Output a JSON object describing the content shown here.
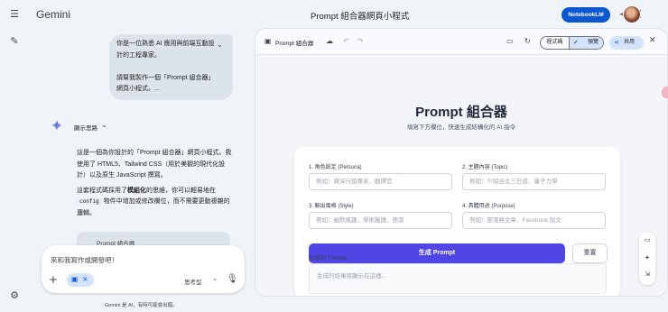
{
  "app": {
    "brand": "Gemini",
    "title": "Prompt 組合器網頁小程式",
    "notebooklm_label": "NotebookLM"
  },
  "icons": {
    "menu": "menu-icon",
    "new_chat": "edit-icon",
    "settings": "gear-icon",
    "share": "share-icon",
    "more": "more-vert-icon",
    "spark": "gemini-spark-icon"
  },
  "chat": {
    "user_message": "你是一位熟悉 AI 應用與前端互動設計的工程專家。\n\n請幫我製作一個「Prompt 組合器」網頁小程式。...",
    "thinking_label": "顯示思路",
    "response_p1": "這是一個為你設計的「Prompt 組合器」網頁小程式。我使用了 HTML5、Tailwind CSS（用於美觀的現代化設計）以及原生 JavaScript 撰寫。",
    "response_p2_a": "這套程式碼採用了",
    "response_p2_bold": "模組化",
    "response_p2_b": "的思維，你可以輕易地在",
    "response_p2_code": "config",
    "response_p2_c": "物件中增加或修改欄位，而不需要更動複雜的邏輯。",
    "code_card_title": "Prompt 組合器",
    "input_placeholder": "來和我寫作或開發吧！",
    "mode_label": "思考型",
    "footer_note": "Gemini 是 AI，有時可能會出錯。"
  },
  "canvas": {
    "title": "Prompt 組合器",
    "toggle_code": "程式碼",
    "toggle_preview": "預覽",
    "share_label": "共用",
    "app_heading": "Prompt 組合器",
    "app_subtitle": "填寫下方欄位，快速生成結構化的 AI 指令",
    "fields": [
      {
        "label": "1. 角色設定 (Persona)",
        "placeholder": "例如：資深行銷專家、翻譯官"
      },
      {
        "label": "2. 主題內容 (Topic)",
        "placeholder": "例如：介紹台北三日遊、量子力學"
      },
      {
        "label": "3. 輸出風格 (Style)",
        "placeholder": "例如：幽默風趣、學術嚴謹、簡潔"
      },
      {
        "label": "4. 具體用途 (Purpose)",
        "placeholder": "例如：部落格文章、Facebook 貼文"
      }
    ],
    "generate_button": "生成 Prompt",
    "reset_button": "重置",
    "output_label": "生成的 Prompt：",
    "output_placeholder": "生成的結果將顯示在這裡..."
  },
  "colors": {
    "primary_button": "#4f46e5",
    "notebooklm": "#0b57d0",
    "bubble": "#dde3ea",
    "background": "#f0f4f9"
  }
}
